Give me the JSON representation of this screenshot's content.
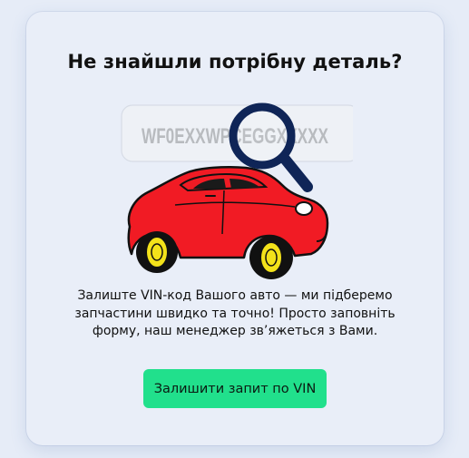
{
  "card": {
    "title": "Не знайшли потрібну деталь?",
    "vin_sample": "WF0EXXWPCEGGXXXXX",
    "description": "Залиште VIN-код Вашого авто — ми підберемо запчастини швидко та точно! Просто заповніть форму, наш менеджер зв’яжеться з Вами.",
    "button_label": "Залишити запит по VIN"
  },
  "colors": {
    "background": "#e6ecf7",
    "card": "#e9eef8",
    "button": "#21e08c",
    "car": "#f11b24",
    "magnifier": "#0f2557",
    "wheel_rim": "#f3e21a"
  },
  "icons": {
    "magnifier": "magnifier-icon",
    "car": "car-illustration"
  }
}
